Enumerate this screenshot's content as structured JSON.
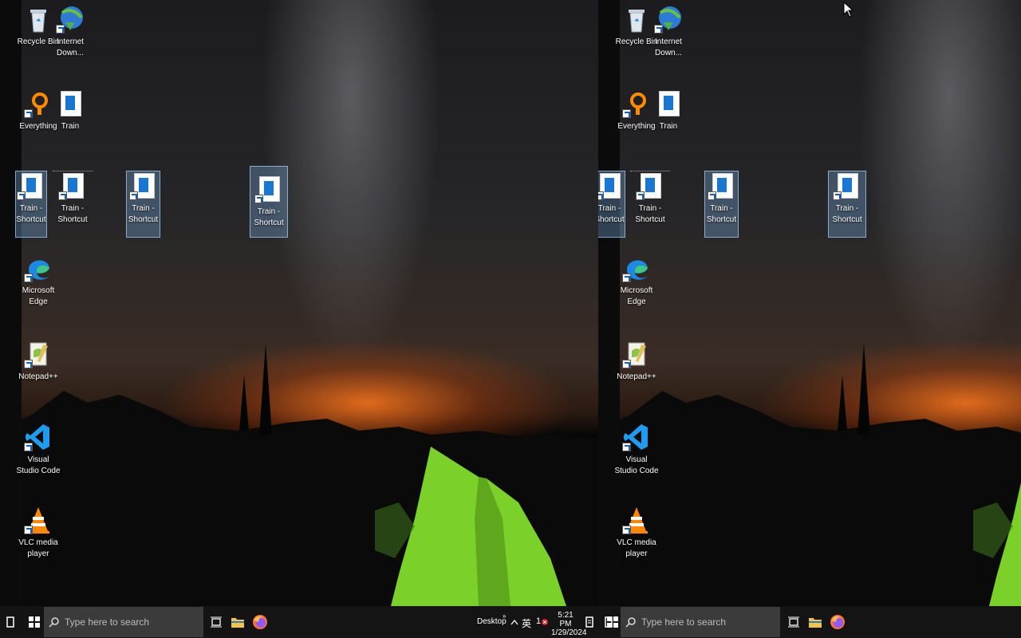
{
  "desktop_left": {
    "icons": [
      {
        "id": "recycle",
        "label": "Recycle Bin",
        "icon": "recycle-bin-icon"
      },
      {
        "id": "idm",
        "label": "Internet Down...",
        "icon": "internet-download-manager-icon"
      },
      {
        "id": "everything",
        "label": "Everything",
        "icon": "everything-search-icon"
      },
      {
        "id": "train",
        "label": "Train",
        "icon": "document-icon"
      },
      {
        "id": "train-shortcut-1",
        "label": "Train - Shortcut",
        "icon": "document-shortcut-icon"
      },
      {
        "id": "train-shortcut-2",
        "label": "Train - Shortcut",
        "icon": "document-shortcut-icon"
      },
      {
        "id": "train-shortcut-3",
        "label": "Train - Shortcut",
        "icon": "document-shortcut-icon"
      },
      {
        "id": "train-shortcut-4",
        "label": "Train - Shortcut",
        "icon": "document-shortcut-icon"
      },
      {
        "id": "edge",
        "label": "Microsoft Edge",
        "icon": "edge-icon"
      },
      {
        "id": "notepadpp",
        "label": "Notepad++",
        "icon": "notepadpp-icon"
      },
      {
        "id": "vscode",
        "label": "Visual Studio Code",
        "icon": "vscode-icon"
      },
      {
        "id": "vlc",
        "label": "VLC media player",
        "icon": "vlc-icon"
      }
    ]
  },
  "desktop_right": {
    "icons": [
      {
        "id": "recycle",
        "label": "Recycle Bin"
      },
      {
        "id": "idm",
        "label": "Internet Down..."
      },
      {
        "id": "everything",
        "label": "Everything"
      },
      {
        "id": "train",
        "label": "Train"
      },
      {
        "id": "train-shortcut-1",
        "label": "Train - Shortcut"
      },
      {
        "id": "train-shortcut-2",
        "label": "Train - Shortcut"
      },
      {
        "id": "train-shortcut-3",
        "label": "Train - Shortcut"
      },
      {
        "id": "train-shortcut-4",
        "label": "Train - Shortcut"
      },
      {
        "id": "edge",
        "label": "Microsoft Edge"
      },
      {
        "id": "notepadpp",
        "label": "Notepad++"
      },
      {
        "id": "vscode",
        "label": "Visual Studio Code"
      },
      {
        "id": "vlc",
        "label": "VLC media player"
      }
    ]
  },
  "taskbar": {
    "search_placeholder": "Type here to search",
    "desktop_label": "Desktop",
    "time": "5:21 PM",
    "date": "1/29/2024",
    "notification_count": "1"
  },
  "colors": {
    "taskbar_bg": "#141414",
    "search_bg": "#3b3b3b",
    "selection": "#78aadc",
    "tent_green": "#7bd12a",
    "horizon_glow": "#ff7a1e"
  }
}
